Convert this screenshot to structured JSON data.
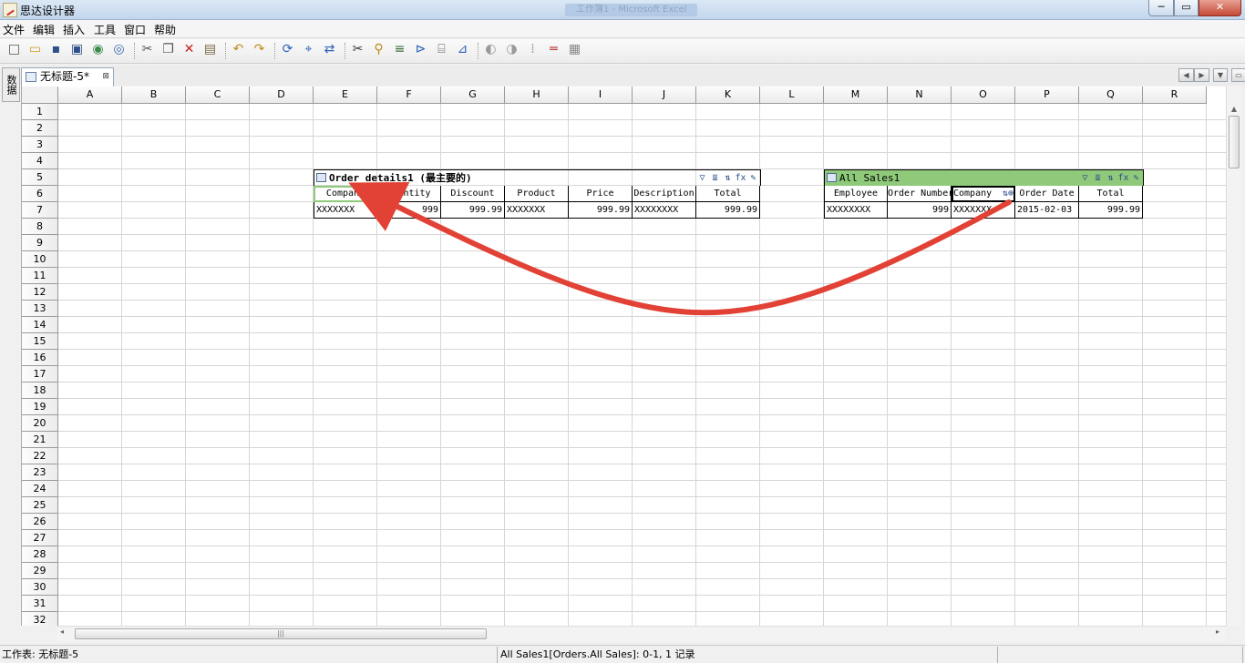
{
  "window": {
    "title": "思达设计器",
    "ghost_title": "工作簿1 - Microsoft Excel",
    "min": "─",
    "max": "▭",
    "close": "✕"
  },
  "menu": [
    "文件",
    "编辑",
    "插入",
    "工具",
    "窗口",
    "帮助"
  ],
  "toolbar_icons": [
    "new-file-icon",
    "open-folder-icon",
    "save-icon",
    "save-all-icon",
    "export-icon",
    "print-preview-icon",
    "cut-icon",
    "copy-icon",
    "delete-icon",
    "paste-icon",
    "undo-icon",
    "redo-icon",
    "refresh-icon",
    "tree-icon",
    "sync-icon",
    "scissor-field-icon",
    "bind-icon",
    "sort-icon",
    "filter-icon",
    "calc-icon",
    "filter-sort-icon",
    "merge-icon",
    "split-icon",
    "layout-icon",
    "split-h-icon",
    "grid-icon"
  ],
  "side_tab": "数据",
  "doc_tab": {
    "label": "无标题-5*",
    "close": "⊠"
  },
  "sheet": {
    "columns": [
      "A",
      "B",
      "C",
      "D",
      "E",
      "F",
      "G",
      "H",
      "I",
      "J",
      "K",
      "L",
      "M",
      "N",
      "O",
      "P",
      "Q",
      "R"
    ],
    "rows": [
      "1",
      "2",
      "3",
      "4",
      "5",
      "6",
      "7",
      "8",
      "9",
      "10",
      "11",
      "12",
      "13",
      "14",
      "15",
      "16",
      "17",
      "18",
      "19",
      "20",
      "21",
      "22",
      "23",
      "24",
      "25",
      "26",
      "27",
      "28",
      "29",
      "30",
      "31",
      "32"
    ]
  },
  "region1": {
    "title": "Order details1 (最主要的)",
    "headers": [
      "Company",
      "Quantity",
      "Discount",
      "Product",
      "Price",
      "Description",
      "Total"
    ],
    "row": [
      "XXXXXXX",
      "999",
      "999.99",
      "XXXXXXX",
      "999.99",
      "XXXXXXXX",
      "999.99"
    ],
    "tools": [
      "▽",
      "≣",
      "⇅",
      "fx",
      "✎"
    ]
  },
  "region2": {
    "title": "All Sales1",
    "headers": [
      "Employee",
      "Order Number",
      "Company",
      "Order Date",
      "Total"
    ],
    "row": [
      "XXXXXXXX",
      "999",
      "XXXXXXX",
      "2015-02-03",
      "999.99"
    ],
    "tools": [
      "▽",
      "≣",
      "⇅",
      "fx",
      "✎"
    ],
    "accent": "#8fca7a",
    "company_markers": "⇅⊕"
  },
  "arrow_color": "#e24236",
  "scroll": {
    "up": "▲",
    "left": "◂",
    "right": "▸",
    "grip": "|||"
  },
  "status": {
    "left": "工作表: 无标题-5",
    "middle": "All Sales1[Orders.All Sales]: 0-1, 1 记录",
    "right": ""
  }
}
